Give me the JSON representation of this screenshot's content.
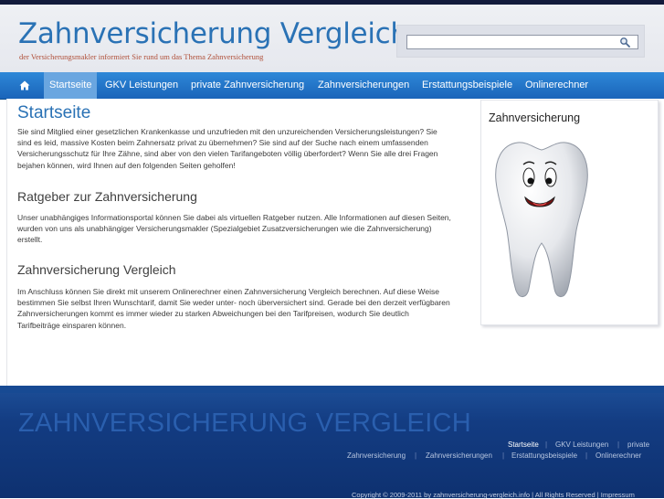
{
  "header": {
    "title": "Zahnversicherung Vergleich",
    "tagline": "der Versicherungsmakler informiert Sie rund um das Thema Zahnversicherung"
  },
  "search": {
    "value": "",
    "icon": "magnifier-icon"
  },
  "nav": {
    "home_icon": "home-icon",
    "items": [
      {
        "label": "Startseite",
        "active": true
      },
      {
        "label": "GKV Leistungen"
      },
      {
        "label": "private Zahnversicherung"
      },
      {
        "label": "Zahnversicherungen"
      },
      {
        "label": "Erstattungsbeispiele"
      },
      {
        "label": "Onlinerechner"
      }
    ]
  },
  "main": {
    "heading": "Startseite",
    "intro": "Sie sind Mitglied einer gesetzlichen Krankenkasse und unzufrieden mit den unzureichenden Versicherungsleistungen? Sie sind es leid, massive Kosten beim Zahnersatz privat zu übernehmen? Sie sind auf der Suche nach einem umfassenden Versicherungsschutz für Ihre Zähne, sind aber von den vielen Tarifangeboten völlig überfordert? Wenn Sie alle drei Fragen  bejahen können, wird Ihnen auf den folgenden Seiten geholfen!",
    "section1_heading": "Ratgeber zur Zahnversicherung",
    "section1_text": "Unser unabhängiges Informationsportal können Sie dabei als virtuellen Ratgeber nutzen. Alle Informationen auf diesen Seiten, wurden von uns als unabhängiger Versicherungsmakler (Spezialgebiet Zusatzversicherungen wie die Zahnversicherung) erstellt.",
    "section2_heading": "Zahnversicherung Vergleich",
    "section2_text": "Im Anschluss können Sie direkt mit unserem Onlinerechner einen Zahnversicherung Vergleich berechnen. Auf diese Weise bestimmen Sie selbst Ihren Wunschtarif, damit Sie weder unter- noch überversichert sind. Gerade bei den derzeit verfügbaren Zahnversicherungen kommt es immer wieder zu starken Abweichungen bei den Tarifpreisen, wodurch Sie deutlich Tarifbeiträge einsparen können."
  },
  "sidebar": {
    "title": "Zahnversicherung",
    "image": "smiling-tooth-illustration"
  },
  "footer": {
    "title": "ZAHNVERSICHERUNG VERGLEICH",
    "links_row1": [
      "Startseite",
      "GKV Leistungen",
      "private"
    ],
    "links_row2": [
      "Zahnversicherung",
      "Zahnversicherungen",
      "Erstattungsbeispiele",
      "Onlinerechner"
    ],
    "separator": "|",
    "copyright": "Copyright © 2009-2011 by zahnversicherung-vergleich.info | All Rights Reserved | Impressum"
  },
  "colors": {
    "title_blue": "#2a72b5",
    "nav_blue": "#1f6fc4",
    "footer_blue": "#133c82",
    "tagline_red": "#b0503a"
  }
}
